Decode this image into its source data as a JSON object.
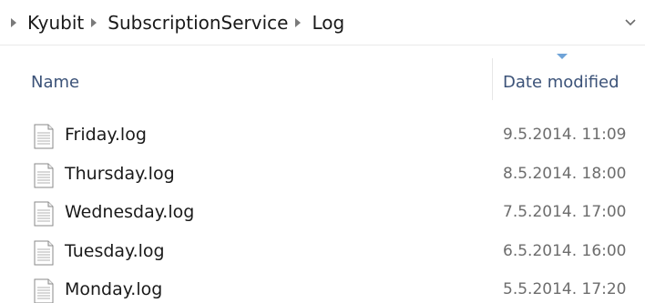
{
  "breadcrumb": {
    "items": [
      "Kyubit",
      "SubscriptionService",
      "Log"
    ]
  },
  "columns": {
    "name": "Name",
    "date_modified": "Date modified"
  },
  "files": [
    {
      "name": "Friday.log",
      "date": "9.5.2014. 11:09",
      "icon": "text-file-icon"
    },
    {
      "name": "Thursday.log",
      "date": "8.5.2014. 18:00",
      "icon": "text-file-icon"
    },
    {
      "name": "Wednesday.log",
      "date": "7.5.2014. 17:00",
      "icon": "text-file-icon"
    },
    {
      "name": "Tuesday.log",
      "date": "6.5.2014. 16:00",
      "icon": "text-file-icon"
    },
    {
      "name": "Monday.log",
      "date": "5.5.2014. 17:20",
      "icon": "text-file-icon"
    }
  ],
  "colors": {
    "header_text": "#3b5278",
    "sort_arrow": "#6fa3d8",
    "date_text": "#6d6d6d"
  }
}
